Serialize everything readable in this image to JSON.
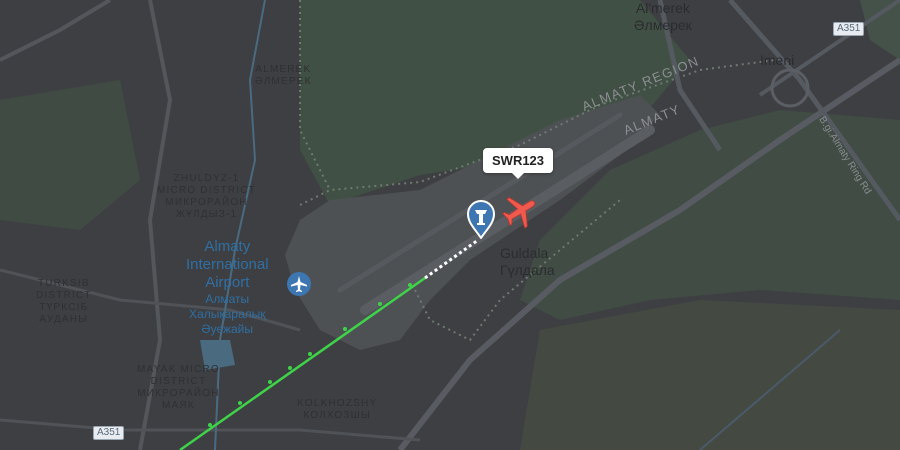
{
  "map": {
    "flight": {
      "callsign": "SWR123"
    },
    "airport": {
      "name_lines": [
        "Almaty",
        "International",
        "Airport"
      ],
      "name_kk_lines": [
        "Алматы",
        "Халықаралық",
        "Әуежайы"
      ]
    },
    "places": {
      "guldala": "Guldala",
      "guldala_kk": "Гүлдала",
      "almerek_top": "Al'merek",
      "almerek_top_kk": "Әлмерек",
      "imeni": "Imeni",
      "almerek_district": [
        "ALMEREK",
        "ӘЛМЕРЕК"
      ],
      "zhuldyz": [
        "ZHULDYZ-1",
        "MICRO DISTRICT",
        "МИКРОРАЙОН",
        "ЖҰЛДЫЗ-1"
      ],
      "turksib": [
        "TURKSIB",
        "DISTRICT",
        "ТҮРКСІБ",
        "АУДАНЫ"
      ],
      "mayak": [
        "MAYAK MICRO",
        "DISTRICT",
        "МИКРОРАЙОН",
        "МАЯК"
      ],
      "kolkhozshy": [
        "KOLKHOZSHY",
        "КОЛХОЗШЫ"
      ],
      "almaty_region": "ALMATY REGION",
      "almaty": "ALMATY",
      "street": "B.gi.Almaty Ring Rd"
    },
    "shields": {
      "a351_top": "A351",
      "a351_bottom": "A351"
    },
    "icons": {
      "plane": "airplane-icon",
      "tower": "control-tower-pin-icon",
      "airport": "airport-marker-icon"
    },
    "colors": {
      "track": "#3fd34a",
      "plane": "#f05a4e",
      "pin": "#3d76b0",
      "airport_text": "#2f6fa3"
    }
  }
}
